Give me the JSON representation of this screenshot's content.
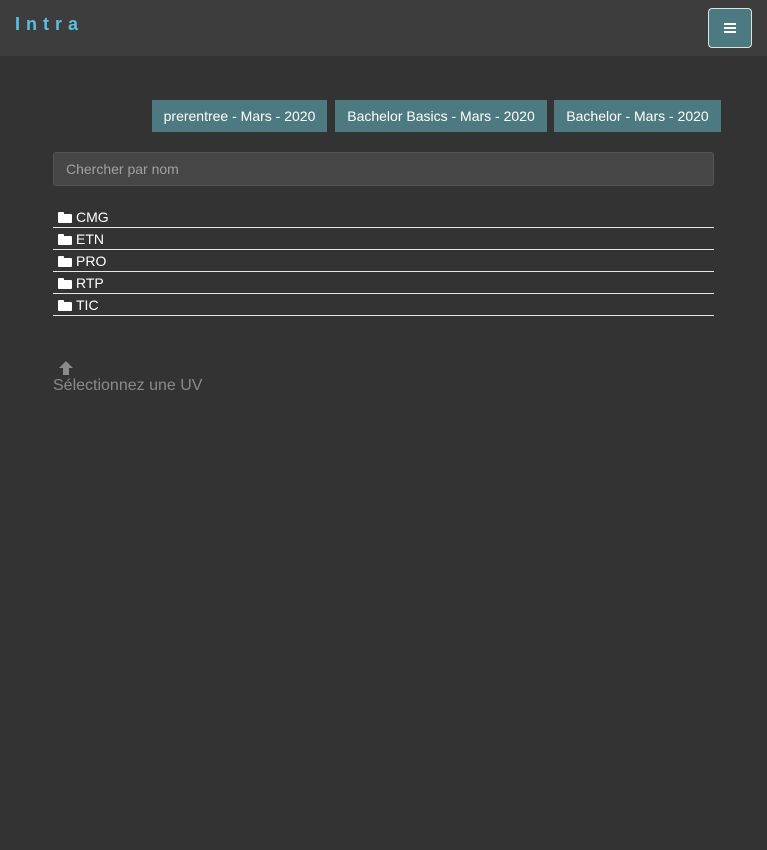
{
  "navbar": {
    "brand": "Intra",
    "menu_icon": "hamburger-menu-icon"
  },
  "tabs": [
    {
      "label": "prerentree - Mars - 2020"
    },
    {
      "label": "Bachelor Basics - Mars - 2020"
    },
    {
      "label": "Bachelor - Mars - 2020"
    }
  ],
  "search": {
    "placeholder": "Chercher par nom",
    "value": ""
  },
  "folders": [
    {
      "label": "CMG",
      "icon": "folder-icon"
    },
    {
      "label": "ETN",
      "icon": "folder-icon"
    },
    {
      "label": "PRO",
      "icon": "folder-icon"
    },
    {
      "label": "RTP",
      "icon": "folder-icon"
    },
    {
      "label": "TIC",
      "icon": "folder-icon"
    }
  ],
  "hint": {
    "icon": "arrow-up-icon",
    "text": "Sélectionnez une UV"
  },
  "colors": {
    "background": "#333333",
    "navbar": "#3d3d3d",
    "brand": "#5bc0de",
    "accent": "#4d7a80",
    "hint_text": "#8a8a8a"
  }
}
